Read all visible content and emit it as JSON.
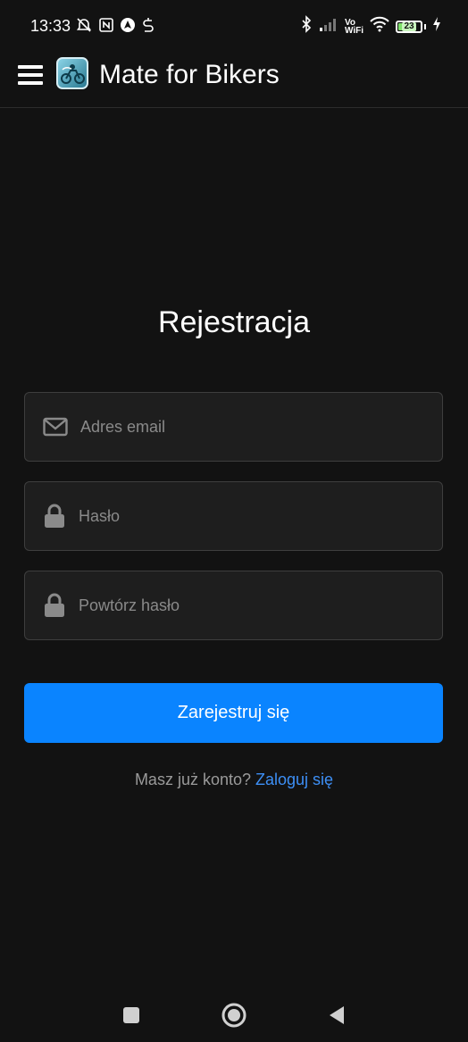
{
  "status_bar": {
    "time": "13:33",
    "battery_level": "23",
    "icons_left": [
      "alarm-off-icon",
      "nfc-icon",
      "navigation-icon",
      "sync-icon"
    ],
    "icons_right": [
      "bluetooth-icon",
      "signal-icon",
      "vowifi-icon",
      "wifi-icon",
      "battery-icon",
      "charging-icon"
    ],
    "vowifi_top": "Vo",
    "vowifi_bottom": "WiFi"
  },
  "app_bar": {
    "title": "Mate for Bikers",
    "menu_icon": "hamburger-icon",
    "logo": "app-logo"
  },
  "form": {
    "title": "Rejestracja",
    "email": {
      "placeholder": "Adres email",
      "value": "",
      "icon": "envelope-icon"
    },
    "password": {
      "placeholder": "Hasło",
      "value": "",
      "icon": "lock-icon"
    },
    "password_repeat": {
      "placeholder": "Powtórz hasło",
      "value": "",
      "icon": "lock-icon"
    },
    "submit_label": "Zarejestruj się",
    "login_prompt": "Masz już konto?",
    "login_link": "Zaloguj się"
  },
  "colors": {
    "background": "#121212",
    "accent": "#0a84ff",
    "link": "#3d8ff5",
    "field_bg": "#1e1e1e",
    "field_border": "#3e3e3e"
  },
  "nav_bar": {
    "buttons": [
      "recents-square-icon",
      "home-circle-icon",
      "back-triangle-icon"
    ]
  }
}
